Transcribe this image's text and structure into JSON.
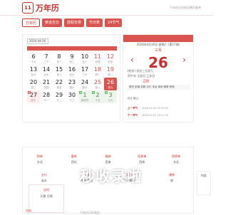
{
  "header": {
    "logo_glyph": "11",
    "logo_text": "万年历",
    "slogan": "万年历日历农历黄历查询"
  },
  "nav": [
    "万年历",
    "黄道吉日",
    "放假安排",
    "节日表",
    "24节气"
  ],
  "calendar": {
    "date_select": "2026-04-26",
    "cells": [
      {
        "d": "6",
        "l": "十九",
        "cls": ""
      },
      {
        "d": "7",
        "l": "二十",
        "cls": ""
      },
      {
        "d": "8",
        "l": "廿一",
        "cls": ""
      },
      {
        "d": "9",
        "l": "廿二",
        "cls": ""
      },
      {
        "d": "10",
        "l": "廿三",
        "cls": ""
      },
      {
        "d": "11",
        "l": "廿四",
        "cls": "we"
      },
      {
        "d": "12",
        "l": "廿五",
        "cls": "we"
      },
      {
        "d": "13",
        "l": "廿六",
        "cls": ""
      },
      {
        "d": "14",
        "l": "廿七",
        "cls": ""
      },
      {
        "d": "15",
        "l": "廿八",
        "cls": ""
      },
      {
        "d": "16",
        "l": "廿九",
        "cls": ""
      },
      {
        "d": "17",
        "l": "三十",
        "cls": ""
      },
      {
        "d": "18",
        "l": "初一",
        "cls": "we"
      },
      {
        "d": "19",
        "l": "初二",
        "cls": "we"
      },
      {
        "d": "20",
        "l": "初三",
        "cls": ""
      },
      {
        "d": "21",
        "l": "初四",
        "cls": ""
      },
      {
        "d": "22",
        "l": "初五",
        "cls": ""
      },
      {
        "d": "23",
        "l": "初六",
        "cls": ""
      },
      {
        "d": "24",
        "l": "初七",
        "cls": ""
      },
      {
        "d": "25",
        "l": "初八",
        "cls": "we"
      },
      {
        "d": "26",
        "l": "初九",
        "cls": "today"
      },
      {
        "d": "27",
        "l": "初十",
        "cls": "work",
        "b": "班"
      },
      {
        "d": "28",
        "l": "十一",
        "cls": ""
      },
      {
        "d": "29",
        "l": "十二",
        "cls": ""
      },
      {
        "d": "30",
        "l": "十三",
        "cls": ""
      },
      {
        "d": "1",
        "l": "劳动节",
        "cls": "rest",
        "b": "休"
      },
      {
        "d": "2",
        "l": "十五",
        "cls": "rest",
        "b": "休"
      },
      {
        "d": "3",
        "l": "十六",
        "cls": "rest",
        "b": "休"
      }
    ]
  },
  "detail": {
    "solar": "2026年4月26日 星期六 (第17周)",
    "lunar_month": "三月",
    "day": "26",
    "lunar_full": "(蛇年) 农历三月初九",
    "ganzhi": "丙午年 壬辰月 乙卯日",
    "tag": "乙卯",
    "yi": "祭祀 祈福 求嗣 出行 沐浴 纳采 嫁娶 修造",
    "ji": "动土 破土",
    "jq_prev": "上一节气",
    "jq_prev_date": "2026-04-20 03:39:00",
    "jq_next": "下一节气",
    "jq_next_date": "2026-05-05 19:47:00",
    "arrow_left": "‹",
    "arrow_right": "›"
  },
  "info": {
    "row1": [
      {
        "k": "财神",
        "v": "东北"
      },
      {
        "k": "喜神",
        "v": "西北"
      },
      {
        "k": "福神",
        "v": "西南"
      },
      {
        "k": "阳贵神",
        "v": "西南"
      },
      {
        "k": "阴贵神",
        "v": "东北"
      }
    ],
    "row2": [
      {
        "k": "五行",
        "v": "溪水"
      },
      {
        "k": "冲煞",
        "v": "冲鸡 煞西"
      },
      {
        "k": "彭祖",
        "v": "乙不栽植"
      },
      {
        "k": "建除",
        "v": "收"
      }
    ],
    "hours_title": "吉时",
    "hours_body": "天恩 月德",
    "hint": "吉凶",
    "watermark": "秒收录啦",
    "side": "时辰",
    "footer": "万年历日历农历"
  },
  "colors": {
    "accent": "#c9302c",
    "rest": "#5cb85c"
  }
}
